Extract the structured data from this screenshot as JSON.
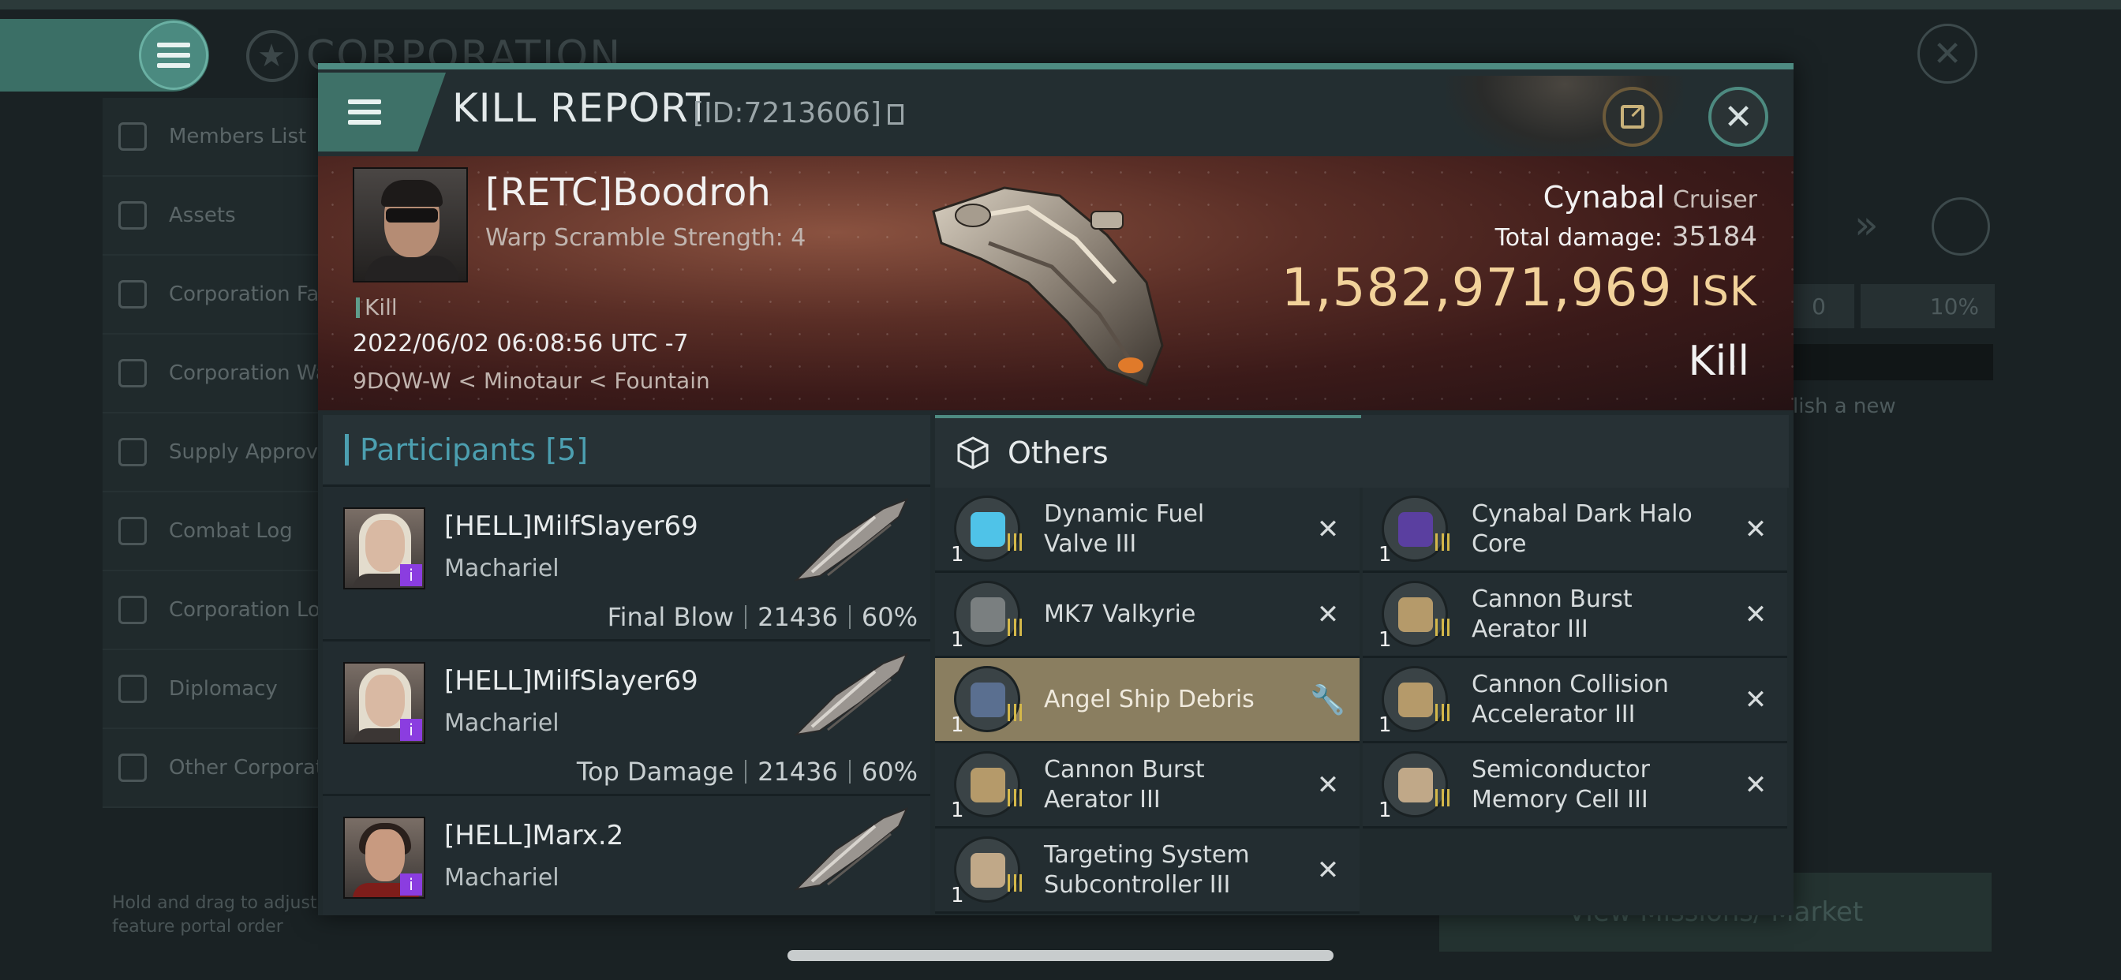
{
  "background": {
    "title": "CORPORATION",
    "sidebar_items": [
      {
        "label": "Members List",
        "icon": "members-icon"
      },
      {
        "label": "Assets",
        "icon": "assets-icon"
      },
      {
        "label": "Corporation Fa",
        "icon": "facilities-icon"
      },
      {
        "label": "Corporation Wa",
        "icon": "wallet-icon"
      },
      {
        "label": "Supply Approva",
        "icon": "supply-icon"
      },
      {
        "label": "Combat Log",
        "icon": "combat-icon"
      },
      {
        "label": "Corporation Lo",
        "icon": "logs-icon"
      },
      {
        "label": "Diplomacy",
        "icon": "diplomacy-icon"
      },
      {
        "label": "Other Corporat",
        "icon": "star-icon"
      }
    ],
    "hint": "Hold and drag to adjust feature portal order",
    "right_zero": "0",
    "right_percent": "10%",
    "right_hint": "lish a new",
    "right_button": "View Missions/ Market"
  },
  "modal": {
    "title": "KILL REPORT",
    "id_label": "[ID:7213606]",
    "victim": {
      "name": "[RETC]Boodroh",
      "warp": "Warp Scramble Strength: 4",
      "tag": "Kill",
      "datetime": "2022/06/02 06:08:56 UTC -7",
      "location": "9DQW-W < Minotaur < Fountain"
    },
    "ship": {
      "name": "Cynabal",
      "class": "Cruiser",
      "damage_label": "Total damage:",
      "damage_value": "35184",
      "isk_value": "1,582,971,969",
      "isk_unit": "ISK",
      "result": "Kill"
    },
    "participants": {
      "title": "Participants",
      "count": "[5]",
      "rows": [
        {
          "name": "[HELL]MilfSlayer69",
          "ship": "Machariel",
          "role": "Final Blow",
          "damage": "21436",
          "percent": "60%",
          "avatar": "female"
        },
        {
          "name": "[HELL]MilfSlayer69",
          "ship": "Machariel",
          "role": "Top Damage",
          "damage": "21436",
          "percent": "60%",
          "avatar": "female"
        },
        {
          "name": "[HELL]Marx.2",
          "ship": "Machariel",
          "role": "",
          "damage": "",
          "percent": "",
          "avatar": "male"
        }
      ]
    },
    "others": {
      "title": "Others",
      "left": [
        {
          "name": "Dynamic Fuel Valve III",
          "qty": "1",
          "color": "#4fc3e8",
          "selected": false
        },
        {
          "name": "MK7  Valkyrie",
          "qty": "1",
          "color": "#7a7f80",
          "selected": false
        },
        {
          "name": "Angel Ship Debris",
          "qty": "1",
          "color": "#5a6f90",
          "selected": true
        },
        {
          "name": "Cannon Burst Aerator III",
          "qty": "1",
          "color": "#b59a6a",
          "selected": false
        },
        {
          "name": "Targeting System Subcontroller III",
          "qty": "1",
          "color": "#c0a888",
          "selected": false
        }
      ],
      "right": [
        {
          "name": "Cynabal Dark Halo Core",
          "qty": "1",
          "color": "#5a3fa0",
          "selected": false
        },
        {
          "name": "Cannon Burst Aerator III",
          "qty": "1",
          "color": "#b59a6a",
          "selected": false
        },
        {
          "name": "Cannon Collision Accelerator III",
          "qty": "1",
          "color": "#b59a6a",
          "selected": false
        },
        {
          "name": "Semiconductor Memory Cell III",
          "qty": "1",
          "color": "#c0a888",
          "selected": false
        }
      ]
    }
  }
}
